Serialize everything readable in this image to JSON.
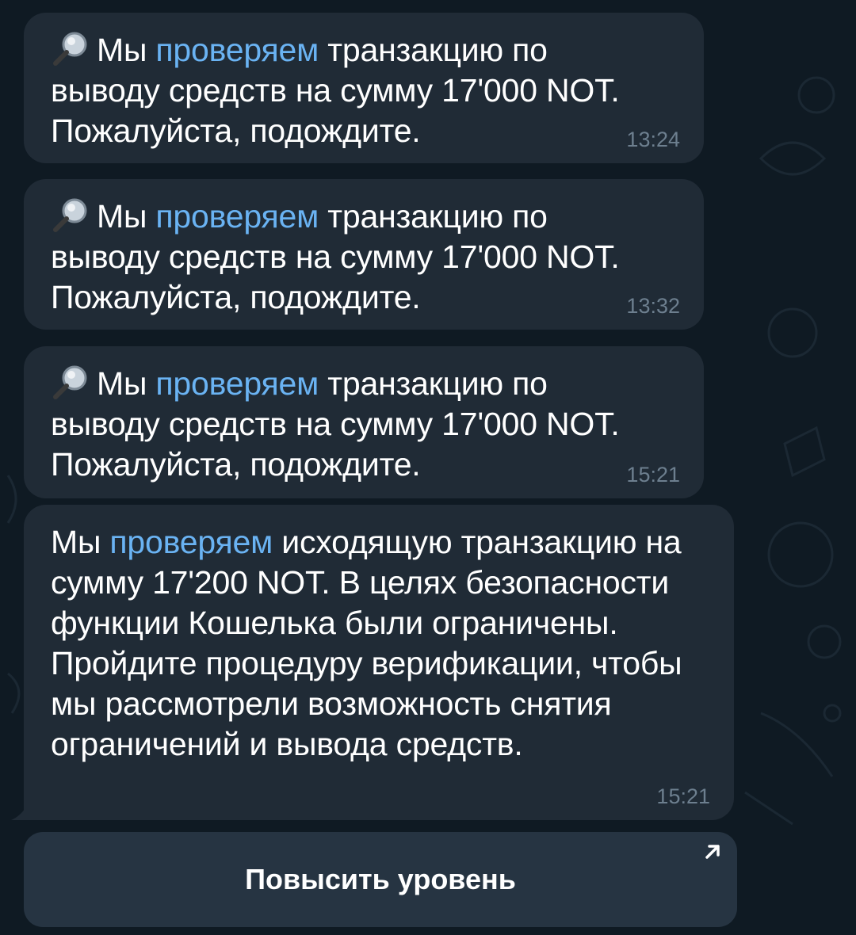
{
  "messages": [
    {
      "prefix": "Мы ",
      "link": "проверяем",
      "suffix": " транзакцию по выводу средств на сумму 17'000 NOT. Пожалуйста, подождите.",
      "time": "13:24"
    },
    {
      "prefix": "Мы ",
      "link": "проверяем",
      "suffix": " транзакцию по выводу средств на сумму 17'000 NOT. Пожалуйста, подождите.",
      "time": "13:32"
    },
    {
      "prefix": "Мы ",
      "link": "проверяем",
      "suffix": " транзакцию по выводу средств на сумму 17'000 NOT. Пожалуйста, подождите.",
      "time": "15:21"
    },
    {
      "prefix": "Мы ",
      "link": "проверяем",
      "suffix": " исходящую транзакцию на сумму 17'200 NOT. В целях безопасности функции Кошелька были ограничены. Пройдите процедуру верификации, чтобы мы рассмотрели возможность снятия ограничений и вывода средств.",
      "time": "15:21"
    }
  ],
  "inline_button": {
    "label": "Повысить уровень",
    "icon": "external-arrow-icon"
  },
  "icons": {
    "message_icon": "magnifying-glass-icon"
  },
  "colors": {
    "background": "#0f1a23",
    "bubble": "#202b36",
    "link": "#6ab3f3",
    "time": "#6d7f8f",
    "button": "#263442"
  }
}
